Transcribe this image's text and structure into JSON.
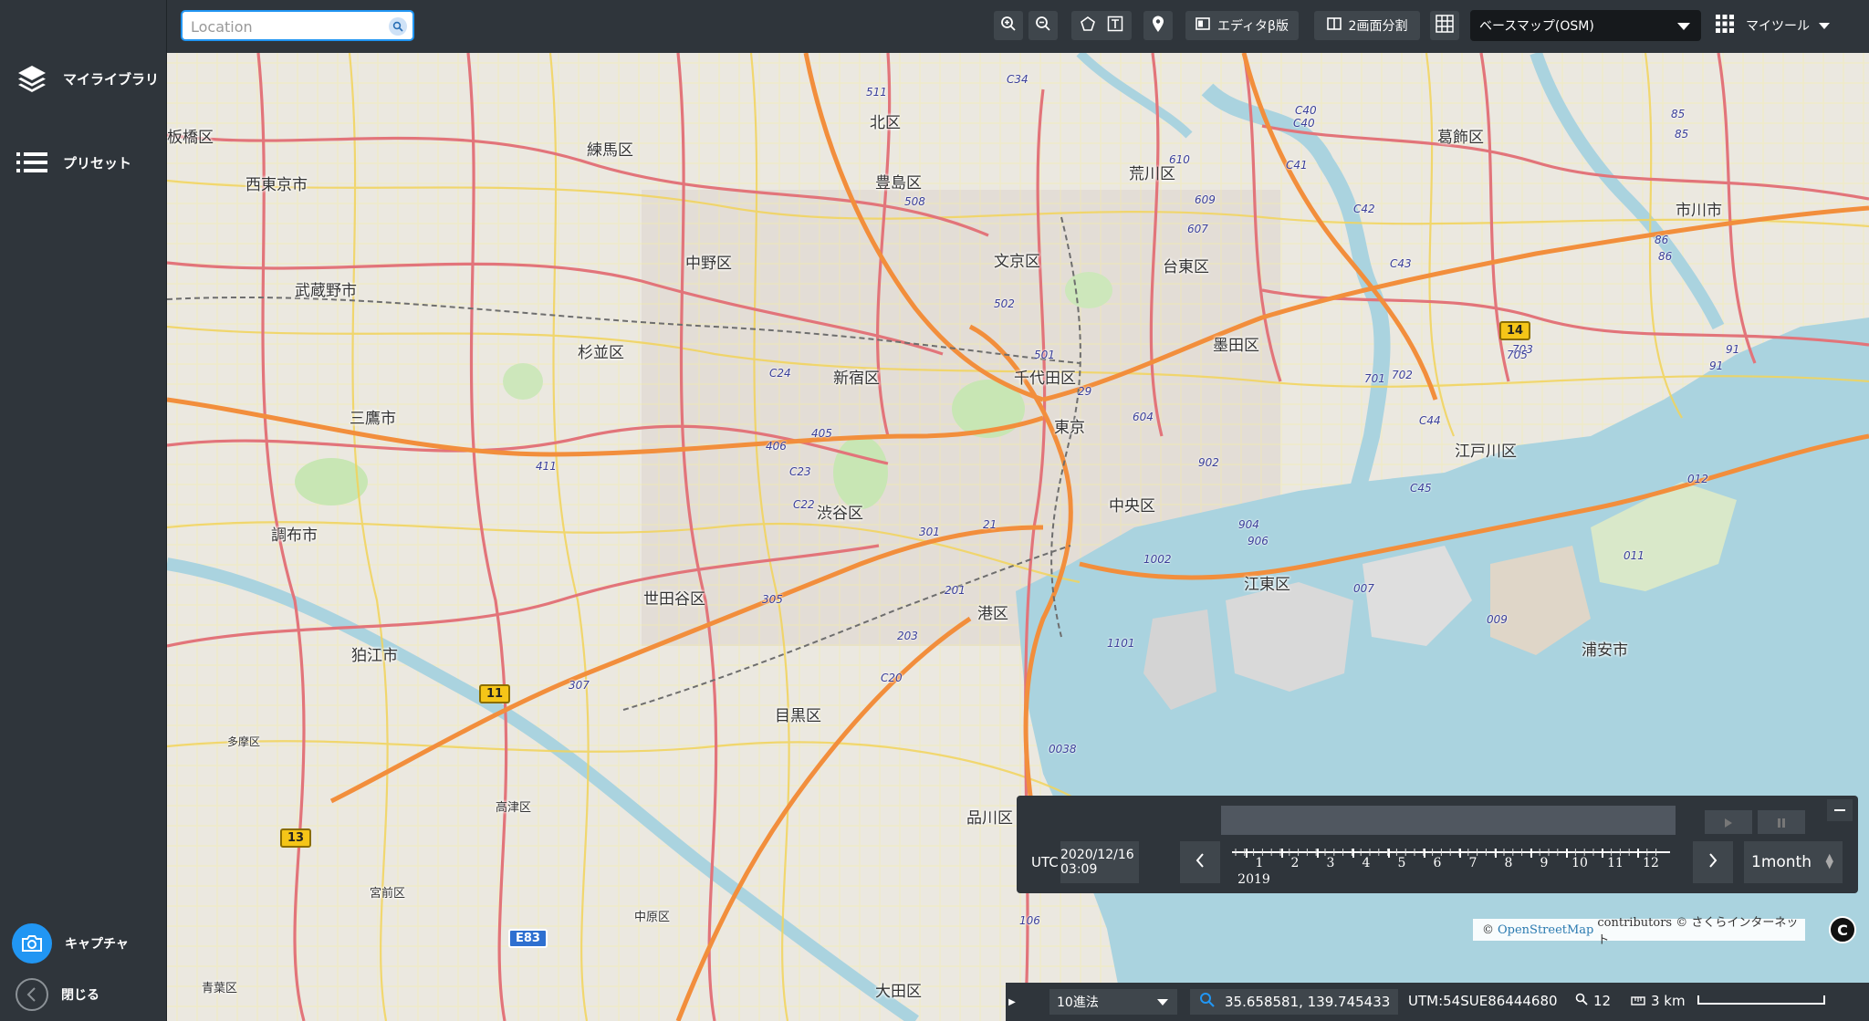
{
  "sidebar": {
    "items": [
      {
        "label": "マイライブラリ",
        "icon": "layers-icon"
      },
      {
        "label": "プリセット",
        "icon": "list-icon"
      }
    ],
    "capture_label": "キャプチャ",
    "close_label": "閉じる"
  },
  "topbar": {
    "search_placeholder": "Location",
    "editor_label": "エディタβ版",
    "split_label": "2画面分割",
    "basemap_selected": "ベースマップ(OSM)",
    "mytool_label": "マイツール"
  },
  "map": {
    "places": [
      "北区",
      "葛飾区",
      "練馬区",
      "板橋区",
      "西東京市",
      "豊島区",
      "荒川区",
      "市川市",
      "中野区",
      "文京区",
      "台東区",
      "武蔵野市",
      "杉並区",
      "墨田区",
      "新宿区",
      "千代田区",
      "三鷹市",
      "東京",
      "江戸川区",
      "中央区",
      "渋谷区",
      "調布市",
      "世田谷区",
      "江東区",
      "港区",
      "狛江市",
      "浦安市",
      "目黒区",
      "品川区",
      "大田区",
      "宮前区",
      "高津区",
      "中原区",
      "青葉区",
      "多摩区"
    ],
    "route_shields": [
      "14",
      "11",
      "13"
    ],
    "expressway_shield": "E83",
    "road_numbers": [
      "C34",
      "C40",
      "C40",
      "C41",
      "C42",
      "C43",
      "609",
      "607",
      "610",
      "511",
      "508",
      "502",
      "501",
      "29",
      "604",
      "C24",
      "405",
      "406",
      "411",
      "C23",
      "C22",
      "301",
      "21",
      "902",
      "904",
      "906",
      "1002",
      "201",
      "203",
      "305",
      "307",
      "C20",
      "0038",
      "106",
      "1101",
      "007",
      "009",
      "011",
      "012",
      "703",
      "702",
      "701",
      "705",
      "C44",
      "C45",
      "85",
      "85",
      "86",
      "86",
      "91",
      "91"
    ]
  },
  "timeline": {
    "utc_label": "UTC",
    "datetime": "2020/12/16 03:09",
    "year_label": "2019",
    "months": [
      "1",
      "2",
      "3",
      "4",
      "5",
      "6",
      "7",
      "8",
      "9",
      "10",
      "11",
      "12"
    ],
    "period": "1month"
  },
  "attribution": {
    "prefix": "©",
    "link": "OpenStreetMap",
    "suffix": "contributors © さくらインターネット",
    "copy_symbol": "C"
  },
  "statusbar": {
    "format": "10進法",
    "coords": "35.658581, 139.745433",
    "utm": "UTM:54SUE86444680",
    "zoom": "12",
    "scale": "3 km"
  }
}
